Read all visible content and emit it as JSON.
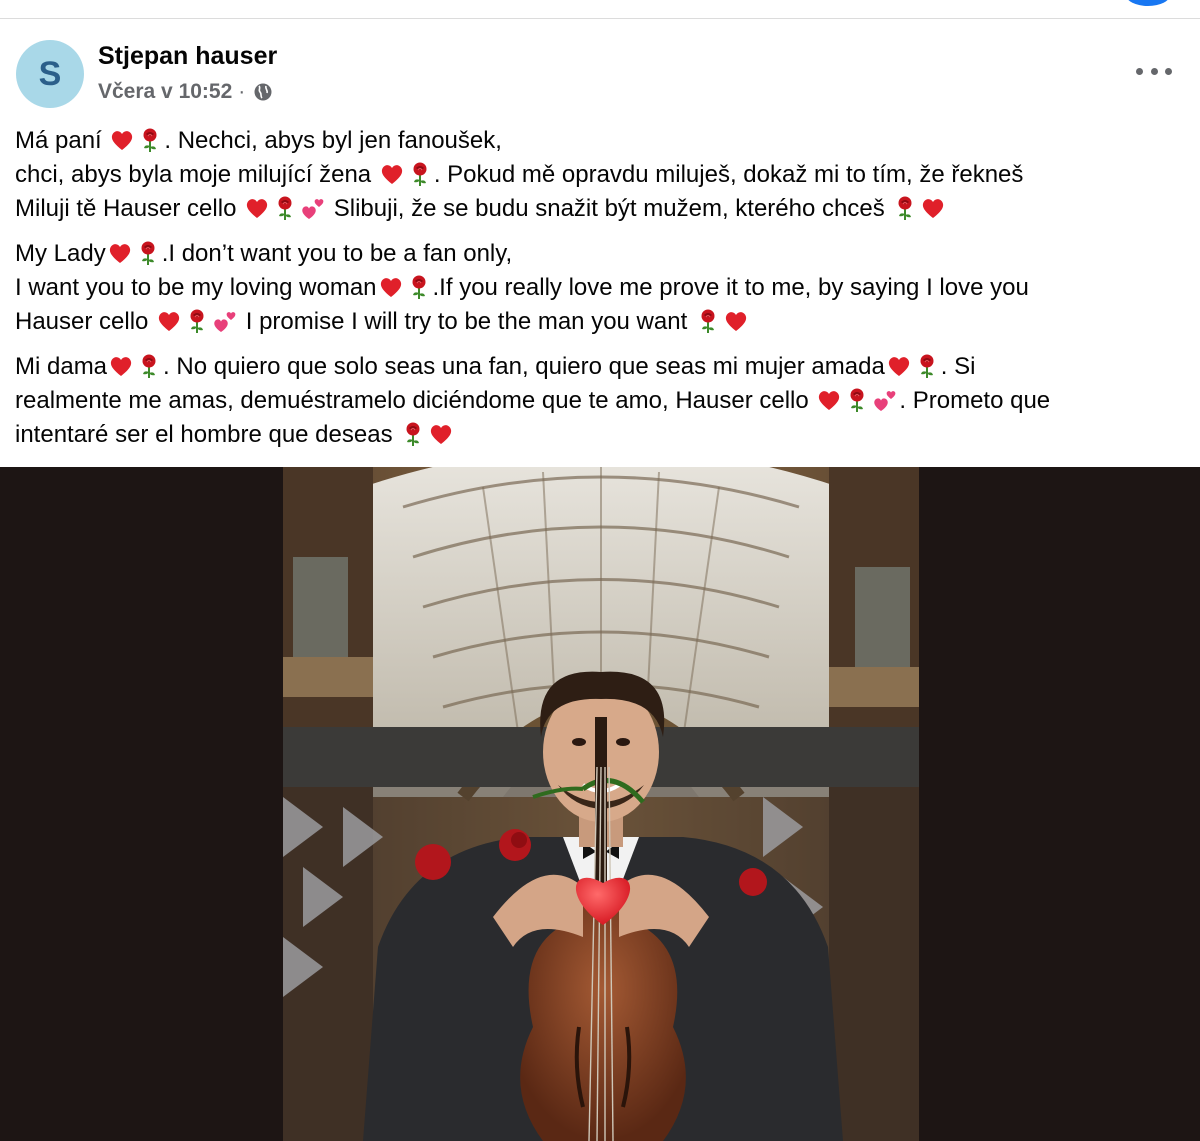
{
  "post": {
    "author": "Stjepan hauser",
    "avatar_letter": "S",
    "time": "Včera v 10:52",
    "separator": "·",
    "privacy_icon": "globe-icon",
    "more_icon": "more-options-icon"
  },
  "text": {
    "czech": [
      [
        "Má paní ",
        "heart",
        "rose",
        ". Nechci, abys byl jen fanoušek,"
      ],
      [
        "chci, abys byla moje milující žena ",
        "heart",
        "rose",
        ". Pokud mě opravdu miluješ, dokaž mi to tím, že řekneš"
      ],
      [
        "Miluji tě Hauser cello ",
        "heart",
        "rose",
        "hearts",
        " Slibuji, že se budu snažit být mužem, kterého chceš ",
        "rose",
        "heart"
      ]
    ],
    "english": [
      [
        "My Lady",
        "heart",
        "rose",
        ".I don’t want you to be a fan only,"
      ],
      [
        "I want you to be my loving woman",
        "heart",
        "rose",
        ".If you really love me prove it to me, by saying I love you"
      ],
      [
        "Hauser cello ",
        "heart",
        "rose",
        "hearts",
        " I promise I will try to be the man you want ",
        "rose",
        "heart"
      ]
    ],
    "spanish": [
      [
        "Mi dama",
        "heart",
        "rose",
        ". No quiero que solo seas una fan, quiero que seas mi mujer amada",
        "heart",
        "rose",
        ". Si"
      ],
      [
        "realmente me amas, demuéstramelo diciéndome que te amo, Hauser cello ",
        "heart",
        "rose",
        "hearts",
        ". Prometo que"
      ],
      [
        "intentaré ser el hombre que deseas ",
        "rose",
        "heart"
      ]
    ]
  },
  "photo": {
    "subject": "cellist-photo",
    "colors": {
      "backdrop": "#1d1514",
      "arch": "#d8d2c4",
      "gold": "#8a6a3a",
      "suit": "#2a2b2e",
      "cello": "#7a3a22",
      "heart": "#e8242e"
    }
  },
  "colors": {
    "accent": "#1877f2",
    "text": "#050505",
    "meta": "#65676b",
    "avatar_bg": "#a9d8e8",
    "avatar_fg": "#2b5f8a"
  }
}
